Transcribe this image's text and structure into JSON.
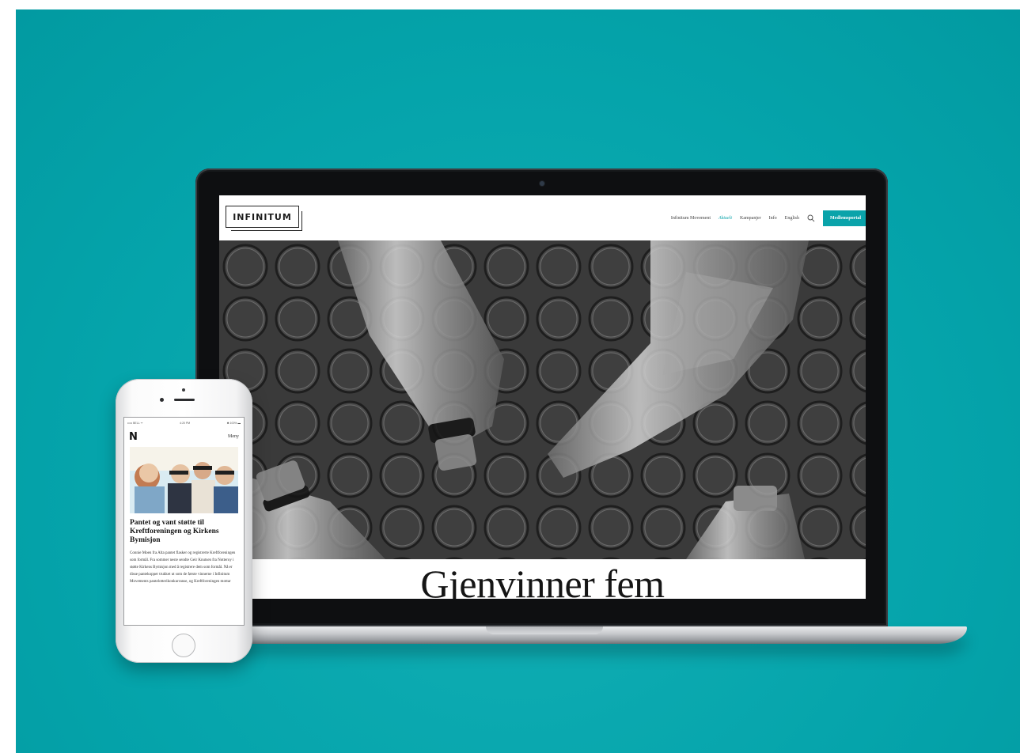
{
  "colors": {
    "background": "#05a4ab",
    "accent": "#0aa3aa",
    "laptop_bezel": "#0e0f11",
    "laptop_base": "#c9cbce"
  },
  "site": {
    "logo": "INFINITUM",
    "nav": [
      {
        "label": "Infinitum Movement",
        "active": false
      },
      {
        "label": "Aktuelt",
        "active": true
      },
      {
        "label": "Kampanjer",
        "active": false
      },
      {
        "label": "Info",
        "active": false
      },
      {
        "label": "English",
        "active": false
      }
    ],
    "search_icon": "search-icon",
    "member_button": "Medlemsportal",
    "article_title": "Gjenvinner fem"
  },
  "phone": {
    "status_left": "••••• BELL ᯤ",
    "status_center": "4:20 PM",
    "status_right": "✱ 100% ▬",
    "logo": "N",
    "menu": "Meny",
    "headline": "Pantet og vant støtte til Kreftforeningen og Kirkens Bymisjon",
    "body": "Connie Moen fra Alta pantet flasker og registrerte Kreftforeningen som formål. Fra sommer neste sendte Geir Knutsen fra Notteroy i støtte Kirkens Bymisjon med å registrere dem som formål. Nå er disse pantekopper trukket ut som de første vinnerne i Infinitum Movements pantelotterikonkurranse, og Kreftforeningen mottar"
  }
}
